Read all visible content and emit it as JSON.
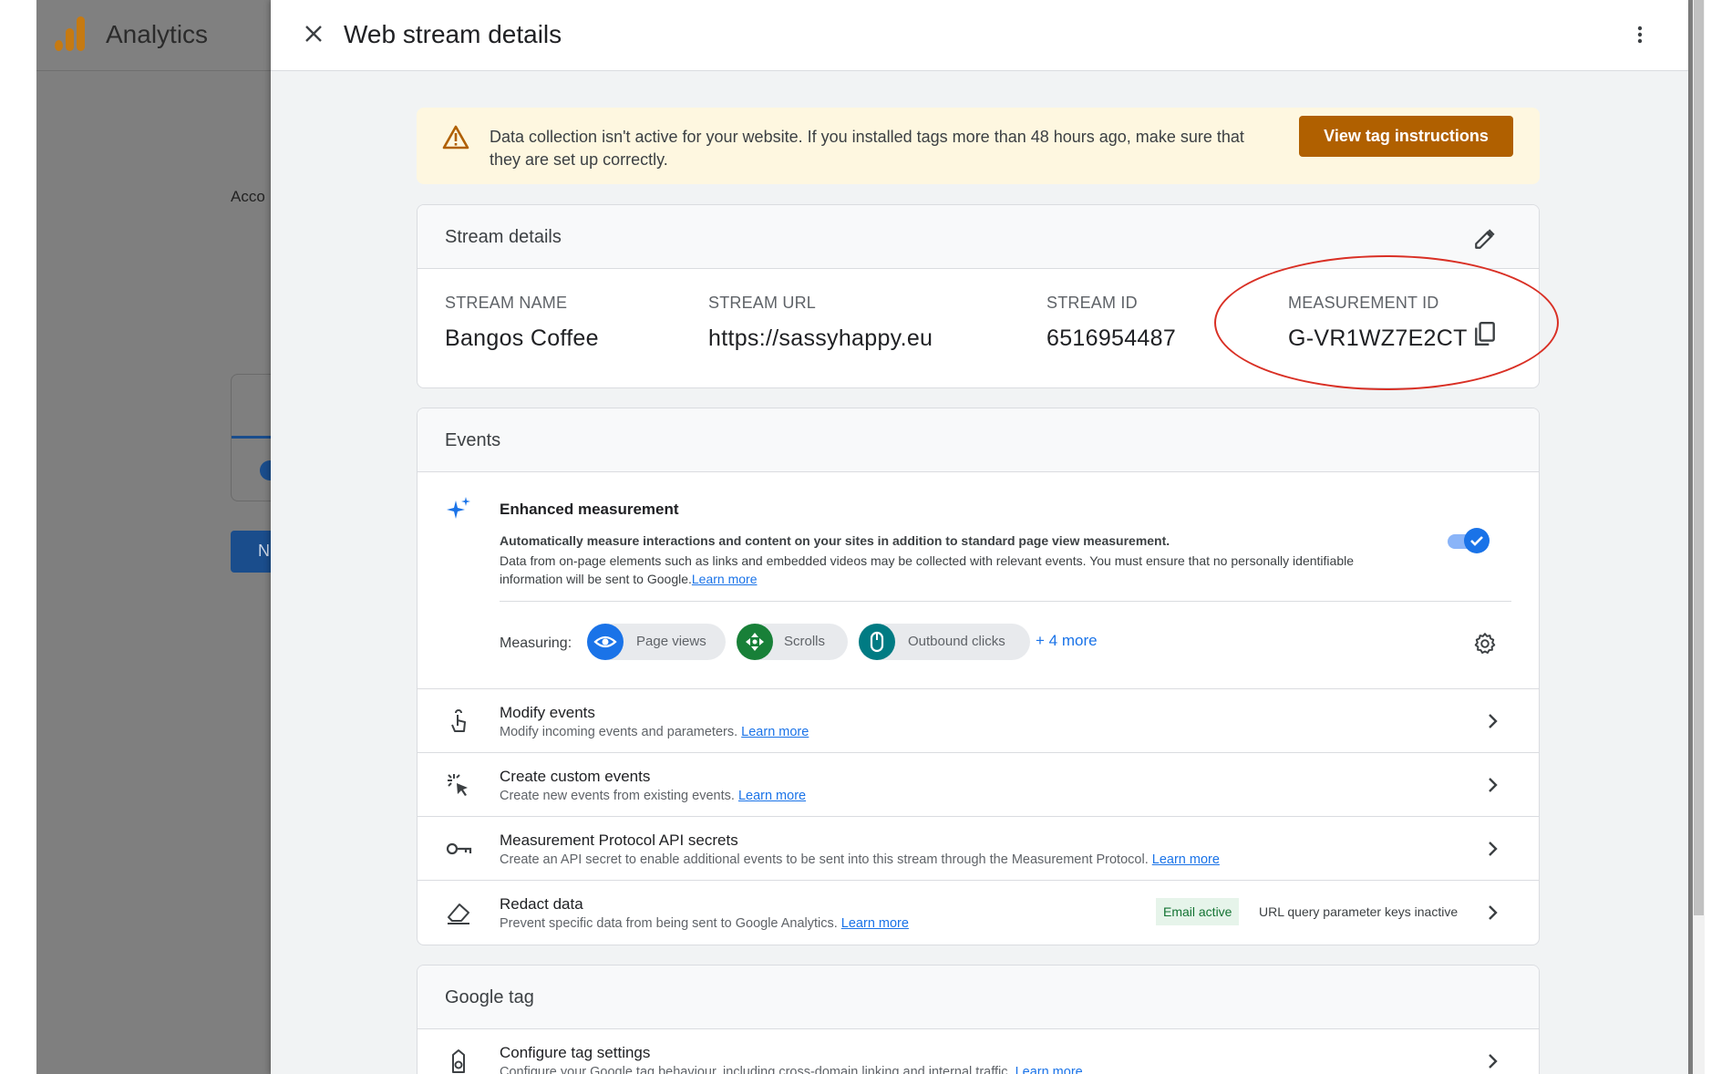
{
  "app": {
    "title": "Analytics",
    "account_label": "Acco",
    "button_label": "N"
  },
  "panel": {
    "title": "Web stream details"
  },
  "banner": {
    "text": "Data collection isn't active for your website. If you installed tags more than 48 hours ago, make sure that they are set up correctly.",
    "button_label": "View tag instructions"
  },
  "stream_details": {
    "title": "Stream details",
    "columns": [
      {
        "label": "STREAM NAME",
        "value": "Bangos Coffee"
      },
      {
        "label": "STREAM URL",
        "value": "https://sassyhappy.eu"
      },
      {
        "label": "STREAM ID",
        "value": "6516954487"
      },
      {
        "label": "MEASUREMENT ID",
        "value": "G-VR1WZ7E2CT"
      }
    ]
  },
  "events": {
    "title": "Events",
    "enhanced": {
      "title": "Enhanced measurement",
      "desc_bold": "Automatically measure interactions and content on your sites in addition to standard page view measurement.",
      "desc": "Data from on-page elements such as links and embedded videos may be collected with relevant events. You must ensure that no personally identifiable information will be sent to Google.",
      "learn_more": "Learn more",
      "enabled": true,
      "measuring_label": "Measuring:",
      "chips": [
        {
          "label": "Page views",
          "icon": "eye-icon",
          "color": "#1a73e8"
        },
        {
          "label": "Scrolls",
          "icon": "scroll-icon",
          "color": "#188038"
        },
        {
          "label": "Outbound clicks",
          "icon": "mouse-icon",
          "color": "#007b83"
        }
      ],
      "more": "+ 4 more"
    },
    "rows": [
      {
        "title": "Modify events",
        "desc": "Modify incoming events and parameters.",
        "link": "Learn more",
        "icon": "touch-icon"
      },
      {
        "title": "Create custom events",
        "desc": "Create new events from existing events.",
        "link": "Learn more",
        "icon": "sparkle-cursor-icon"
      },
      {
        "title": "Measurement Protocol API secrets",
        "desc": "Create an API secret to enable additional events to be sent into this stream through the Measurement Protocol.",
        "link": "Learn more",
        "icon": "key-icon"
      },
      {
        "title": "Redact data",
        "desc": "Prevent specific data from being sent to Google Analytics.",
        "link": "Learn more",
        "icon": "eraser-icon",
        "badge_active": "Email active",
        "badge_inactive": "URL query parameter keys inactive"
      }
    ]
  },
  "google_tag": {
    "title": "Google tag",
    "row": {
      "title": "Configure tag settings",
      "desc": "Configure your Google tag behaviour, including cross-domain linking and internal traffic.",
      "link": "Learn more",
      "icon": "tag-icon"
    }
  },
  "colors": {
    "accent": "#1a73e8",
    "warning_button": "#b06000",
    "banner_bg": "#fef7e0",
    "annotation": "#d93025"
  }
}
